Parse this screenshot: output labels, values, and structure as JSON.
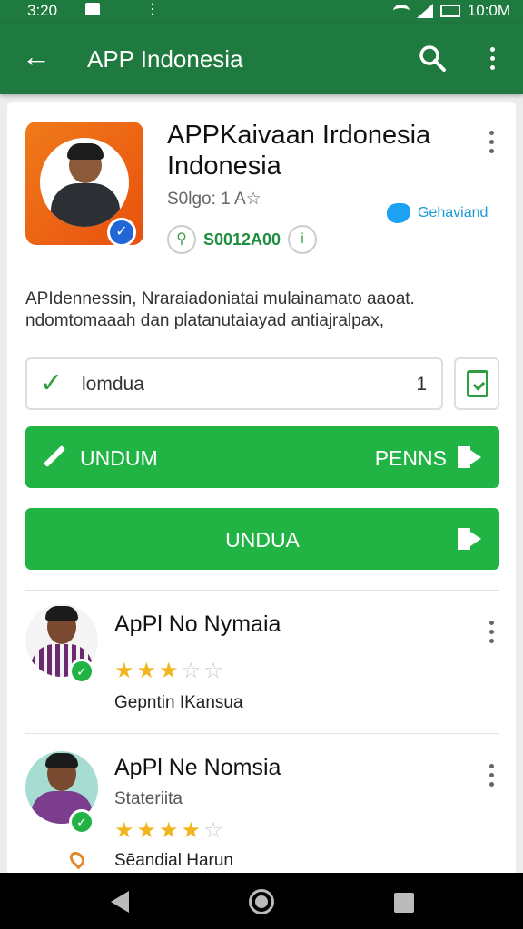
{
  "status_bar": {
    "time_left": "3:20",
    "time_right": "10:0M"
  },
  "app_bar": {
    "title": "APP Indonesia"
  },
  "app": {
    "title_line1": "APPKaivaan Irdonesia",
    "title_line2": "Indonesia",
    "meta": "S0lgo: 1  A☆",
    "developer": "Gehaviand",
    "price": "S0012A00"
  },
  "description": {
    "line1": "APIdennessin, Nraraiadoniatai mulainamato aaoat.",
    "line2": "ndomtomaaah dan platanutaiayad antiajralpax,"
  },
  "input": {
    "value": "lomdua",
    "count": "1"
  },
  "buttons": {
    "primary_left": "UNDUM",
    "primary_right": "PENNS",
    "secondary": "UNDUA"
  },
  "items": [
    {
      "name": "ApPl No Nymaia",
      "subtitle": "",
      "developer": "Gepntin IKansua",
      "rating": 3
    },
    {
      "name": "ApPl Ne Nomsia",
      "subtitle": "Stateriita",
      "developer": "Sēandial Harun",
      "rating": 4
    }
  ],
  "colors": {
    "primary_dark": "#1f7a3f",
    "button_green": "#22b345",
    "star": "#f2b51f",
    "app_icon": "#e8510e"
  }
}
